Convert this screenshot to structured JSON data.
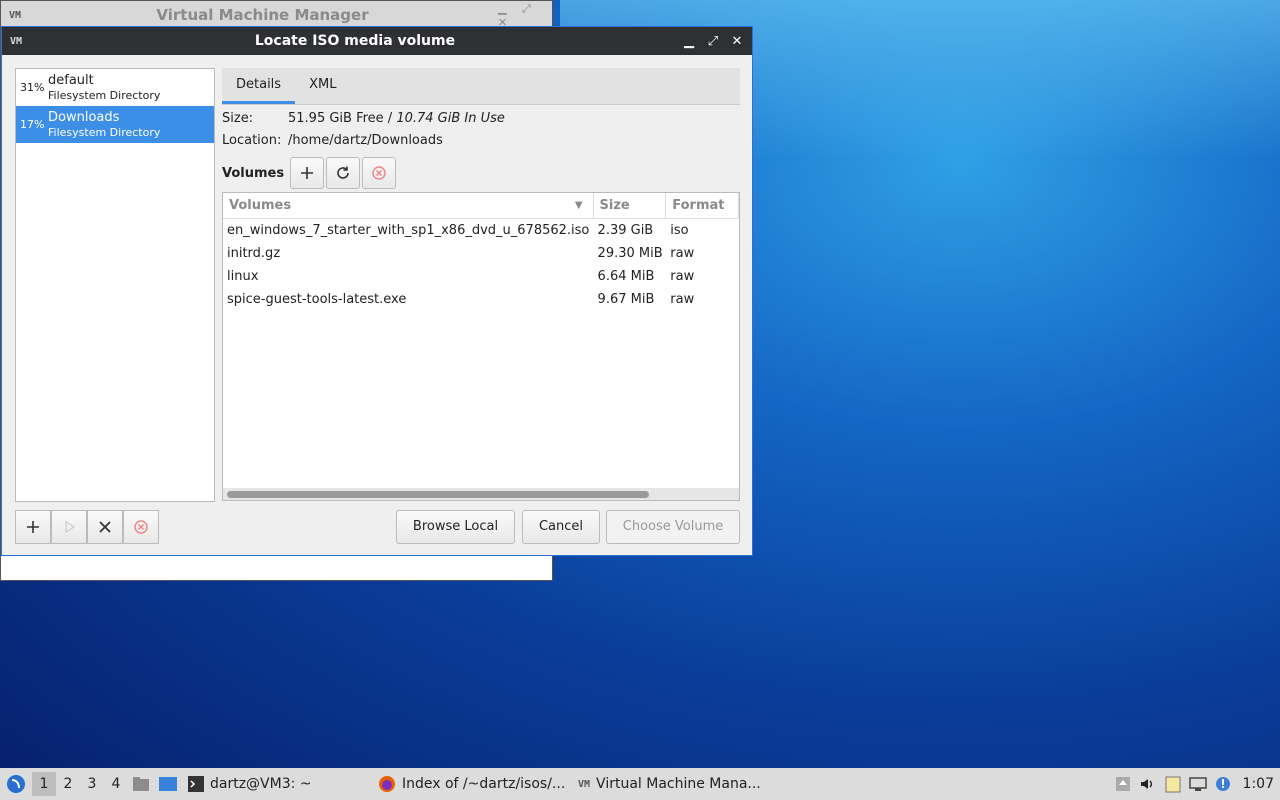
{
  "background_window": {
    "title": "Virtual Machine Manager"
  },
  "dialog": {
    "title": "Locate ISO media volume",
    "pools": [
      {
        "percent": "31%",
        "name": "default",
        "type": "Filesystem Directory",
        "selected": false
      },
      {
        "percent": "17%",
        "name": "Downloads",
        "type": "Filesystem Directory",
        "selected": true
      }
    ],
    "tabs": [
      {
        "label": "Details",
        "active": true
      },
      {
        "label": "XML",
        "active": false
      }
    ],
    "details": {
      "size_label": "Size:",
      "size_free": "51.95 GiB Free",
      "size_sep": " / ",
      "size_in_use": "10.74 GiB In Use",
      "location_label": "Location:",
      "location_value": "/home/dartz/Downloads"
    },
    "volumes_label": "Volumes",
    "table": {
      "columns": [
        "Volumes",
        "Size",
        "Format"
      ],
      "rows": [
        {
          "name": "en_windows_7_starter_with_sp1_x86_dvd_u_678562.iso",
          "size": "2.39 GiB",
          "format": "iso"
        },
        {
          "name": "initrd.gz",
          "size": "29.30 MiB",
          "format": "raw"
        },
        {
          "name": "linux",
          "size": "6.64 MiB",
          "format": "raw"
        },
        {
          "name": "spice-guest-tools-latest.exe",
          "size": "9.67 MiB",
          "format": "raw"
        }
      ]
    },
    "buttons": {
      "browse_local": "Browse Local",
      "cancel": "Cancel",
      "choose_volume": "Choose Volume"
    }
  },
  "taskbar": {
    "workspaces": [
      "1",
      "2",
      "3",
      "4"
    ],
    "tasks": [
      "dartz@VM3: ~",
      "Index of /~dartz/isos/...",
      "Virtual Machine Mana..."
    ],
    "clock": "1:07"
  },
  "colors": {
    "selection": "#3d8ee6",
    "titlebar": "#2e3033",
    "stop_red": "#e05a5a"
  }
}
